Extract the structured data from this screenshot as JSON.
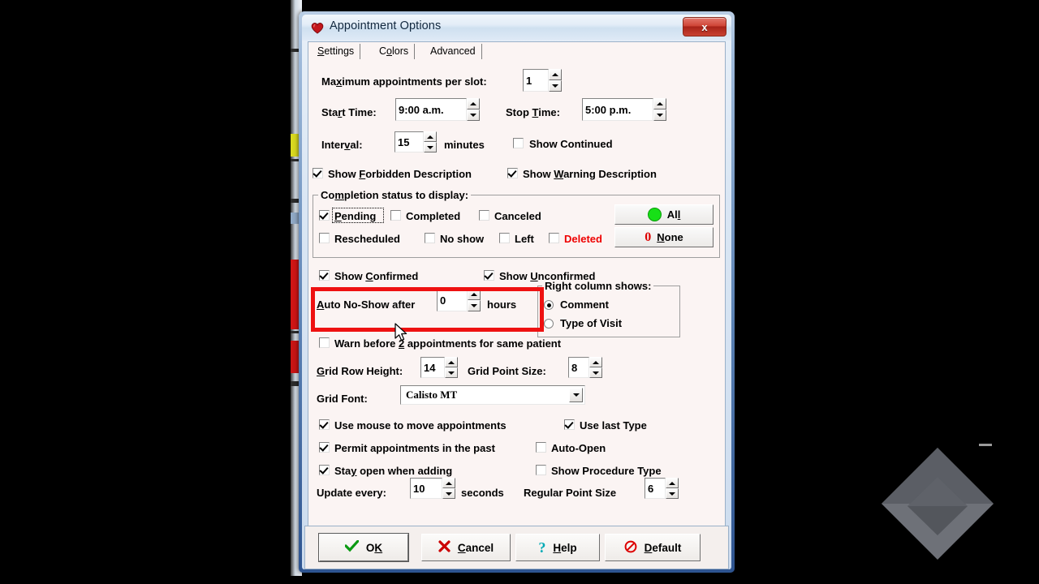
{
  "window": {
    "title": "Appointment Options",
    "icon": "heart-icon",
    "close_label": "x"
  },
  "tabs": [
    {
      "label": "Settings",
      "selected": true
    },
    {
      "label": "Colors",
      "selected": false
    },
    {
      "label": "Advanced",
      "selected": false
    }
  ],
  "settings": {
    "max_appointments_label": "Maximum appointments per slot:",
    "max_appointments_value": "1",
    "start_time_label": "Start Time:",
    "start_time_value": "9:00 a.m.",
    "stop_time_label": "Stop Time:",
    "stop_time_value": "5:00 p.m.",
    "interval_label": "Interval:",
    "interval_value": "15",
    "minutes_label": "minutes",
    "show_continued_label": "Show Continued",
    "show_continued_checked": false,
    "show_forbidden_label": "Show Forbidden Description",
    "show_forbidden_checked": true,
    "show_warning_label": "Show Warning Description",
    "show_warning_checked": true
  },
  "completion_group": {
    "title": "Completion status to display:",
    "statuses": [
      {
        "label": "Pending",
        "checked": true,
        "focused": true,
        "color": "#000000"
      },
      {
        "label": "Completed",
        "checked": false,
        "focused": false,
        "color": "#000000"
      },
      {
        "label": "Canceled",
        "checked": false,
        "focused": false,
        "color": "#000000"
      },
      {
        "label": "Rescheduled",
        "checked": false,
        "focused": false,
        "color": "#000000"
      },
      {
        "label": "No show",
        "checked": false,
        "focused": false,
        "color": "#000000"
      },
      {
        "label": "Left",
        "checked": false,
        "focused": false,
        "color": "#000000"
      },
      {
        "label": "Deleted",
        "checked": false,
        "focused": false,
        "color": "#ee0000"
      }
    ],
    "all_button": "All",
    "none_button": "None",
    "all_color": "#00dd00",
    "none_color": "#dd0000"
  },
  "confirm": {
    "show_confirmed_label": "Show Confirmed",
    "show_confirmed_checked": true,
    "show_unconfirmed_label": "Show Unconfirmed",
    "show_unconfirmed_checked": true
  },
  "highlighted": {
    "auto_noshow_label": "Auto No-Show after",
    "auto_noshow_value": "0",
    "hours_label": "hours",
    "highlight_color": "#ee1111"
  },
  "right_column_group": {
    "title": "Right column shows:",
    "options": [
      {
        "label": "Comment",
        "selected": true
      },
      {
        "label": "Type of Visit",
        "selected": false
      }
    ]
  },
  "warn": {
    "label_part1": "Warn before",
    "count": "2",
    "label_part2": "appointments for same patient",
    "checked": false
  },
  "grid": {
    "row_height_label": "Grid Row Height:",
    "row_height_value": "14",
    "point_size_label": "Grid Point Size:",
    "point_size_value": "8",
    "font_label": "Grid Font:",
    "font_value": "Calisto MT"
  },
  "options": [
    {
      "label": "Use mouse to move appointments",
      "checked": true
    },
    {
      "label": "Use last Type",
      "checked": true
    },
    {
      "label": "Permit appointments in the past",
      "checked": true
    },
    {
      "label": "Auto-Open",
      "checked": false
    },
    {
      "label": "Stay open when adding",
      "checked": true
    },
    {
      "label": "Show Procedure Type",
      "checked": false
    }
  ],
  "update": {
    "update_every_label": "Update every:",
    "update_every_value": "10",
    "seconds_label": "seconds",
    "regular_point_label": "Regular Point Size",
    "regular_point_value": "6"
  },
  "buttons": [
    {
      "label": "OK",
      "icon": "check-icon",
      "default": true
    },
    {
      "label": "Cancel",
      "icon": "x-icon",
      "default": false
    },
    {
      "label": "Help",
      "icon": "question-icon",
      "default": false
    },
    {
      "label": "Default",
      "icon": "no-entry-icon",
      "default": false
    }
  ]
}
